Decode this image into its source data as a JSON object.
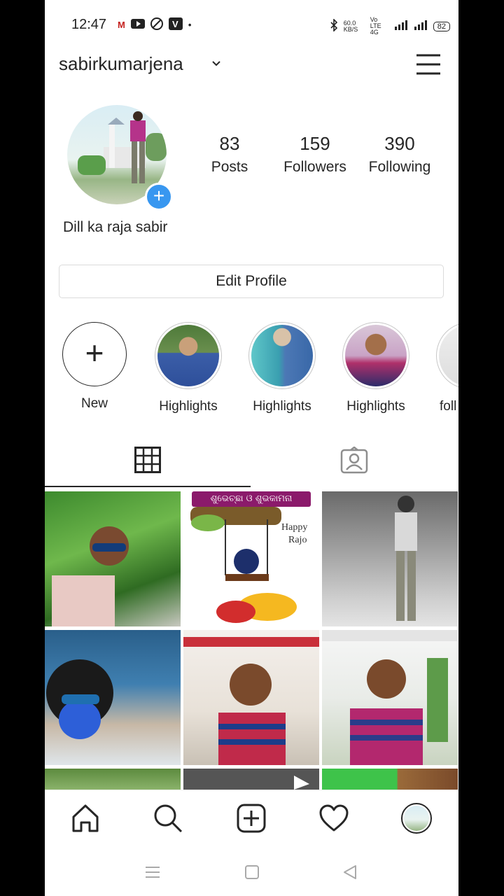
{
  "status_bar": {
    "time": "12:47",
    "speed": "60.0 KB/S",
    "network": "Vo LTE 4G",
    "battery": "82"
  },
  "header": {
    "username": "sabirkumarjena",
    "chevron_icon": "chevron-down-icon",
    "menu_icon": "hamburger-menu-icon"
  },
  "profile": {
    "posts_count": "83",
    "posts_label": "Posts",
    "followers_count": "159",
    "followers_label": "Followers",
    "following_count": "390",
    "following_label": "Following",
    "bio_name": "Dill ka raja sabir",
    "edit_button": "Edit Profile"
  },
  "highlights": [
    {
      "label": "New"
    },
    {
      "label": "Highlights"
    },
    {
      "label": "Highlights"
    },
    {
      "label": "Highlights"
    },
    {
      "label": "foll"
    }
  ],
  "tabs": [
    {
      "name": "grid",
      "icon": "grid-icon",
      "active": true
    },
    {
      "name": "tagged",
      "icon": "tagged-person-icon",
      "active": false
    }
  ],
  "grid_posts": {
    "post2_title": "ଶୁଭେଚ୍ଛା ଓ ଶୁଭକାମନା",
    "post2_caption_line1": "Happy",
    "post2_caption_line2": "Rajo"
  },
  "bottom_nav": [
    "home-icon",
    "search-icon",
    "new-post-icon",
    "activity-heart-icon",
    "profile-avatar"
  ],
  "colors": {
    "accent": "#3897f0",
    "text": "#262626",
    "border": "#dbdbdb"
  }
}
